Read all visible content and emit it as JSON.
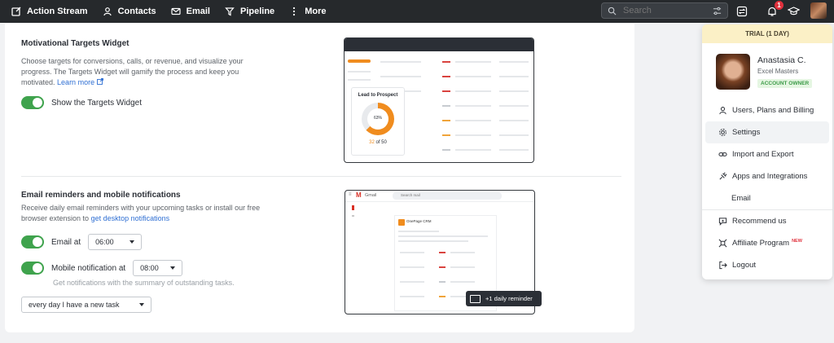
{
  "nav": {
    "items": [
      {
        "label": "Action Stream",
        "icon": "action-stream-icon"
      },
      {
        "label": "Contacts",
        "icon": "person-icon"
      },
      {
        "label": "Email",
        "icon": "envelope-icon"
      },
      {
        "label": "Pipeline",
        "icon": "funnel-icon"
      },
      {
        "label": "More",
        "icon": "more-vertical-icon"
      }
    ],
    "search_placeholder": "Search",
    "notification_count": "1"
  },
  "targets": {
    "title": "Motivational Targets Widget",
    "desc": "Choose targets for conversions, calls, or revenue, and visualize your progress. The Targets Widget will gamify the process and keep you motivated.",
    "learn_more": "Learn more",
    "toggle_label": "Show the Targets Widget",
    "toggle_on": true,
    "preview": {
      "card_title": "Lead to Prospect",
      "percent": "63%",
      "progress_value": "32",
      "progress_of": "of 50"
    }
  },
  "reminders": {
    "title": "Email reminders and mobile notifications",
    "desc": "Receive daily email reminders with your upcoming tasks or install our free browser extension to",
    "desc_link": "get desktop notifications",
    "email_label": "Email at",
    "email_time": "06:00",
    "email_on": true,
    "mobile_label": "Mobile notification at",
    "mobile_time": "08:00",
    "mobile_on": true,
    "hint": "Get notifications with the summary of outstanding tasks.",
    "frequency": "every day I have a new task",
    "preview_badge": "+1 daily reminder",
    "preview_app": "Gmail",
    "preview_search": "Search mail",
    "preview_sender": "OnePage CRM"
  },
  "menu": {
    "trial": "TRIAL (1 DAY)",
    "user_name": "Anastasia C.",
    "company": "Excel Masters",
    "role": "ACCOUNT OWNER",
    "items": [
      {
        "label": "Users, Plans and Billing",
        "icon": "person-icon"
      },
      {
        "label": "Settings",
        "icon": "gear-icon"
      },
      {
        "label": "Import and Export",
        "icon": "link-icon"
      },
      {
        "label": "Apps and Integrations",
        "icon": "plug-icon"
      },
      {
        "label": "Email",
        "icon": ""
      },
      {
        "label": "Recommend us",
        "icon": "chat-icon"
      },
      {
        "label": "Affiliate Program",
        "icon": "affiliate-icon",
        "tag": "NEW"
      },
      {
        "label": "Logout",
        "icon": "logout-icon"
      }
    ]
  }
}
